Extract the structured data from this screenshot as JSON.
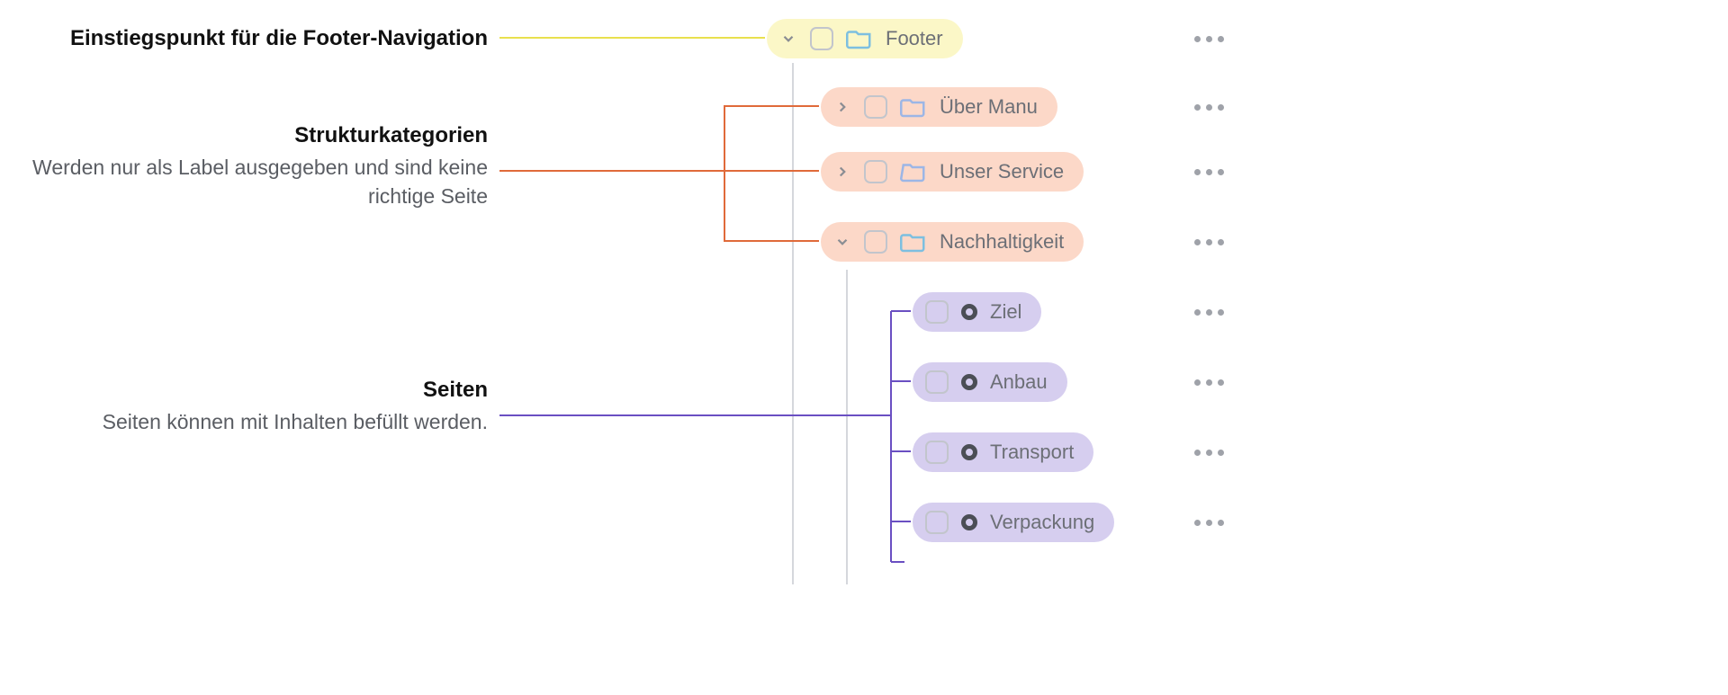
{
  "annotations": {
    "footer_entry": {
      "title": "Einstiegspunkt für die Footer-Navigation"
    },
    "categories": {
      "title": "Strukturkategorien",
      "sub": "Werden nur als Label ausgegeben und sind keine richtige Seite"
    },
    "pages": {
      "title": "Seiten",
      "sub": "Seiten können mit Inhalten befüllt werden."
    }
  },
  "tree": {
    "root": {
      "label": "Footer",
      "expanded": true
    },
    "categories": [
      {
        "label": "Über Manu",
        "expanded": false
      },
      {
        "label": "Unser Service",
        "expanded": false
      },
      {
        "label": "Nachhaltigkeit",
        "expanded": true
      }
    ],
    "pages": [
      {
        "label": "Ziel"
      },
      {
        "label": "Anbau"
      },
      {
        "label": "Transport"
      },
      {
        "label": "Verpackung"
      }
    ]
  },
  "colors": {
    "connector_yellow": "#e9e04e",
    "connector_orange": "#e06a3a",
    "connector_violet": "#6a4fc2"
  }
}
